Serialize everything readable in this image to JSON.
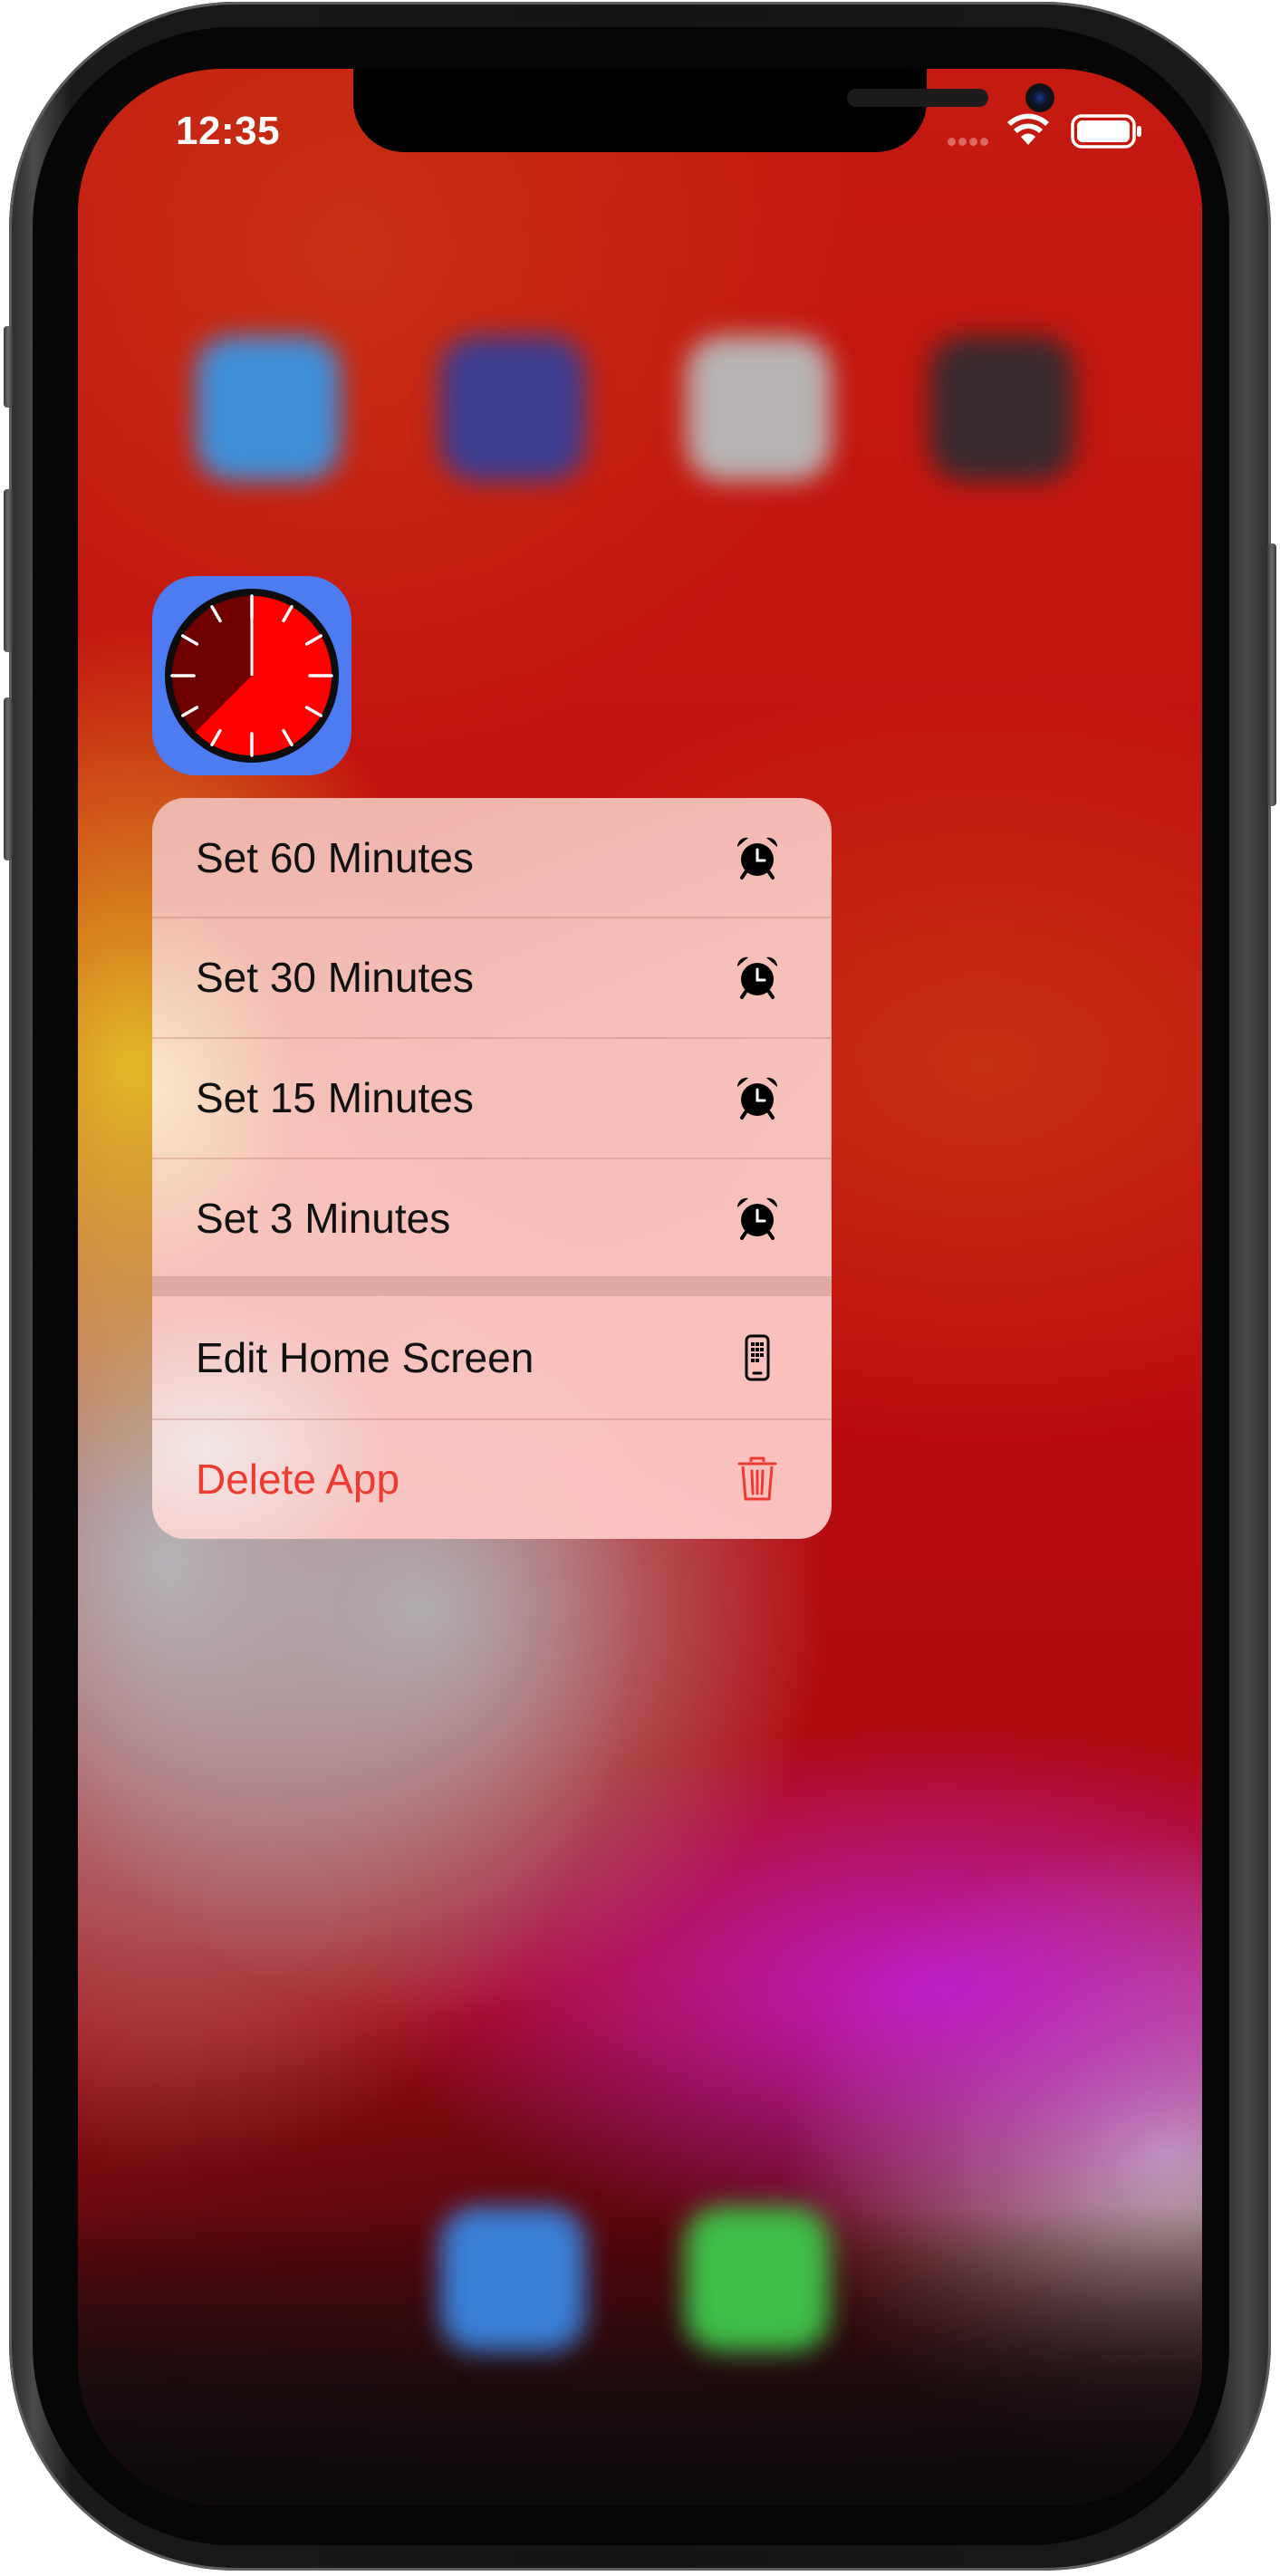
{
  "status_bar": {
    "time": "12:35"
  },
  "app": {
    "icon_name": "timer-clock-icon",
    "accent_color": "#4d7cf2"
  },
  "context_menu": {
    "actions": [
      {
        "label": "Set 60 Minutes",
        "icon": "alarm-icon"
      },
      {
        "label": "Set 30 Minutes",
        "icon": "alarm-icon"
      },
      {
        "label": "Set 15 Minutes",
        "icon": "alarm-icon"
      },
      {
        "label": "Set 3 Minutes",
        "icon": "alarm-icon"
      }
    ],
    "system_actions": [
      {
        "label": "Edit Home Screen",
        "icon": "phone-apps-icon"
      },
      {
        "label": "Delete App",
        "icon": "trash-icon",
        "color": "#ee3b32"
      }
    ]
  }
}
